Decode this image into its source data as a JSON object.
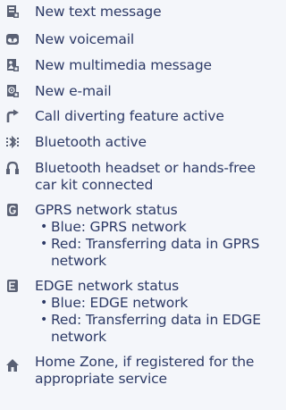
{
  "items": [
    {
      "icon": "new-text-message-icon",
      "text": "New text message"
    },
    {
      "icon": "voicemail-icon",
      "text": "New voicemail"
    },
    {
      "icon": "new-multimedia-message-icon",
      "text": "New multimedia message"
    },
    {
      "icon": "new-email-icon",
      "text": "New e-mail"
    },
    {
      "icon": "call-diverting-icon",
      "text": "Call diverting feature active"
    },
    {
      "icon": "bluetooth-active-icon",
      "text": "Bluetooth active"
    },
    {
      "icon": "bluetooth-headset-icon",
      "text": "Bluetooth headset or hands-free car kit connected"
    },
    {
      "icon": "gprs-status-icon",
      "text": "GPRS network status",
      "bullets": [
        "Blue: GPRS network",
        "Red: Transferring data in GPRS network"
      ]
    },
    {
      "icon": "edge-status-icon",
      "text": "EDGE network status",
      "bullets": [
        "Blue: EDGE network",
        "Red: Transferring data in EDGE network"
      ]
    },
    {
      "icon": "home-zone-icon",
      "text": "Home Zone, if registered for the appropriate service"
    }
  ],
  "bullet_symbol": "•",
  "colors": {
    "text": "#2d3a66",
    "icon": "#5a6174",
    "background": "#f4f6fa"
  }
}
